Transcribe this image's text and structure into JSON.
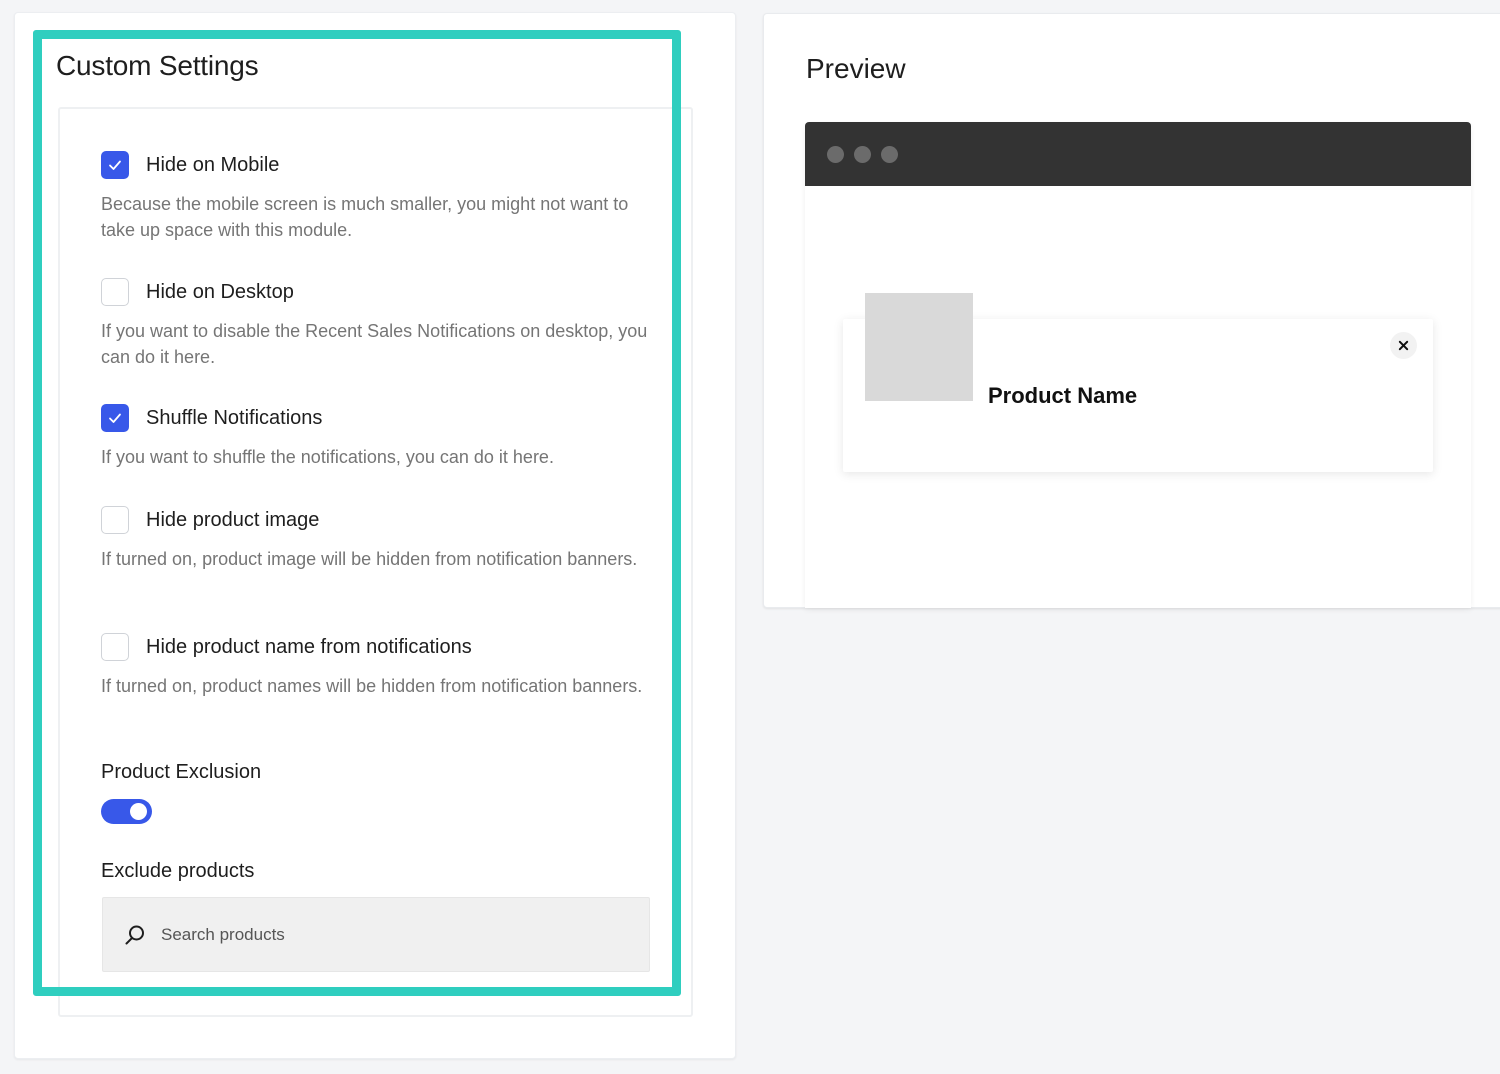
{
  "settings": {
    "title": "Custom Settings",
    "options": [
      {
        "label": "Hide on Mobile",
        "checked": true,
        "description": "Because the mobile screen is much smaller, you might not want to take up space with this module."
      },
      {
        "label": "Hide on Desktop",
        "checked": false,
        "description": "If you want to disable the Recent Sales Notifications on desktop, you can do it here."
      },
      {
        "label": "Shuffle Notifications",
        "checked": true,
        "description": "If you want to shuffle the notifications, you can do it here."
      },
      {
        "label": "Hide product image",
        "checked": false,
        "description": "If turned on, product image will be hidden from notification banners."
      },
      {
        "label": "Hide product name from notifications",
        "checked": false,
        "description": "If turned on, product names will be hidden from notification banners."
      }
    ],
    "product_exclusion": {
      "label": "Product Exclusion",
      "enabled": true
    },
    "exclude_products": {
      "label": "Exclude products",
      "placeholder": "Search products",
      "value": ""
    }
  },
  "preview": {
    "title": "Preview",
    "notification": {
      "product_name": "Product Name"
    }
  },
  "colors": {
    "accent": "#3858e9",
    "highlight": "#2fcebf",
    "browser_bar": "#333333",
    "thumbnail": "#d9d9d9"
  },
  "icons": {
    "checkbox_checked": "checkmark-icon",
    "search": "search-icon",
    "close": "close-icon"
  }
}
